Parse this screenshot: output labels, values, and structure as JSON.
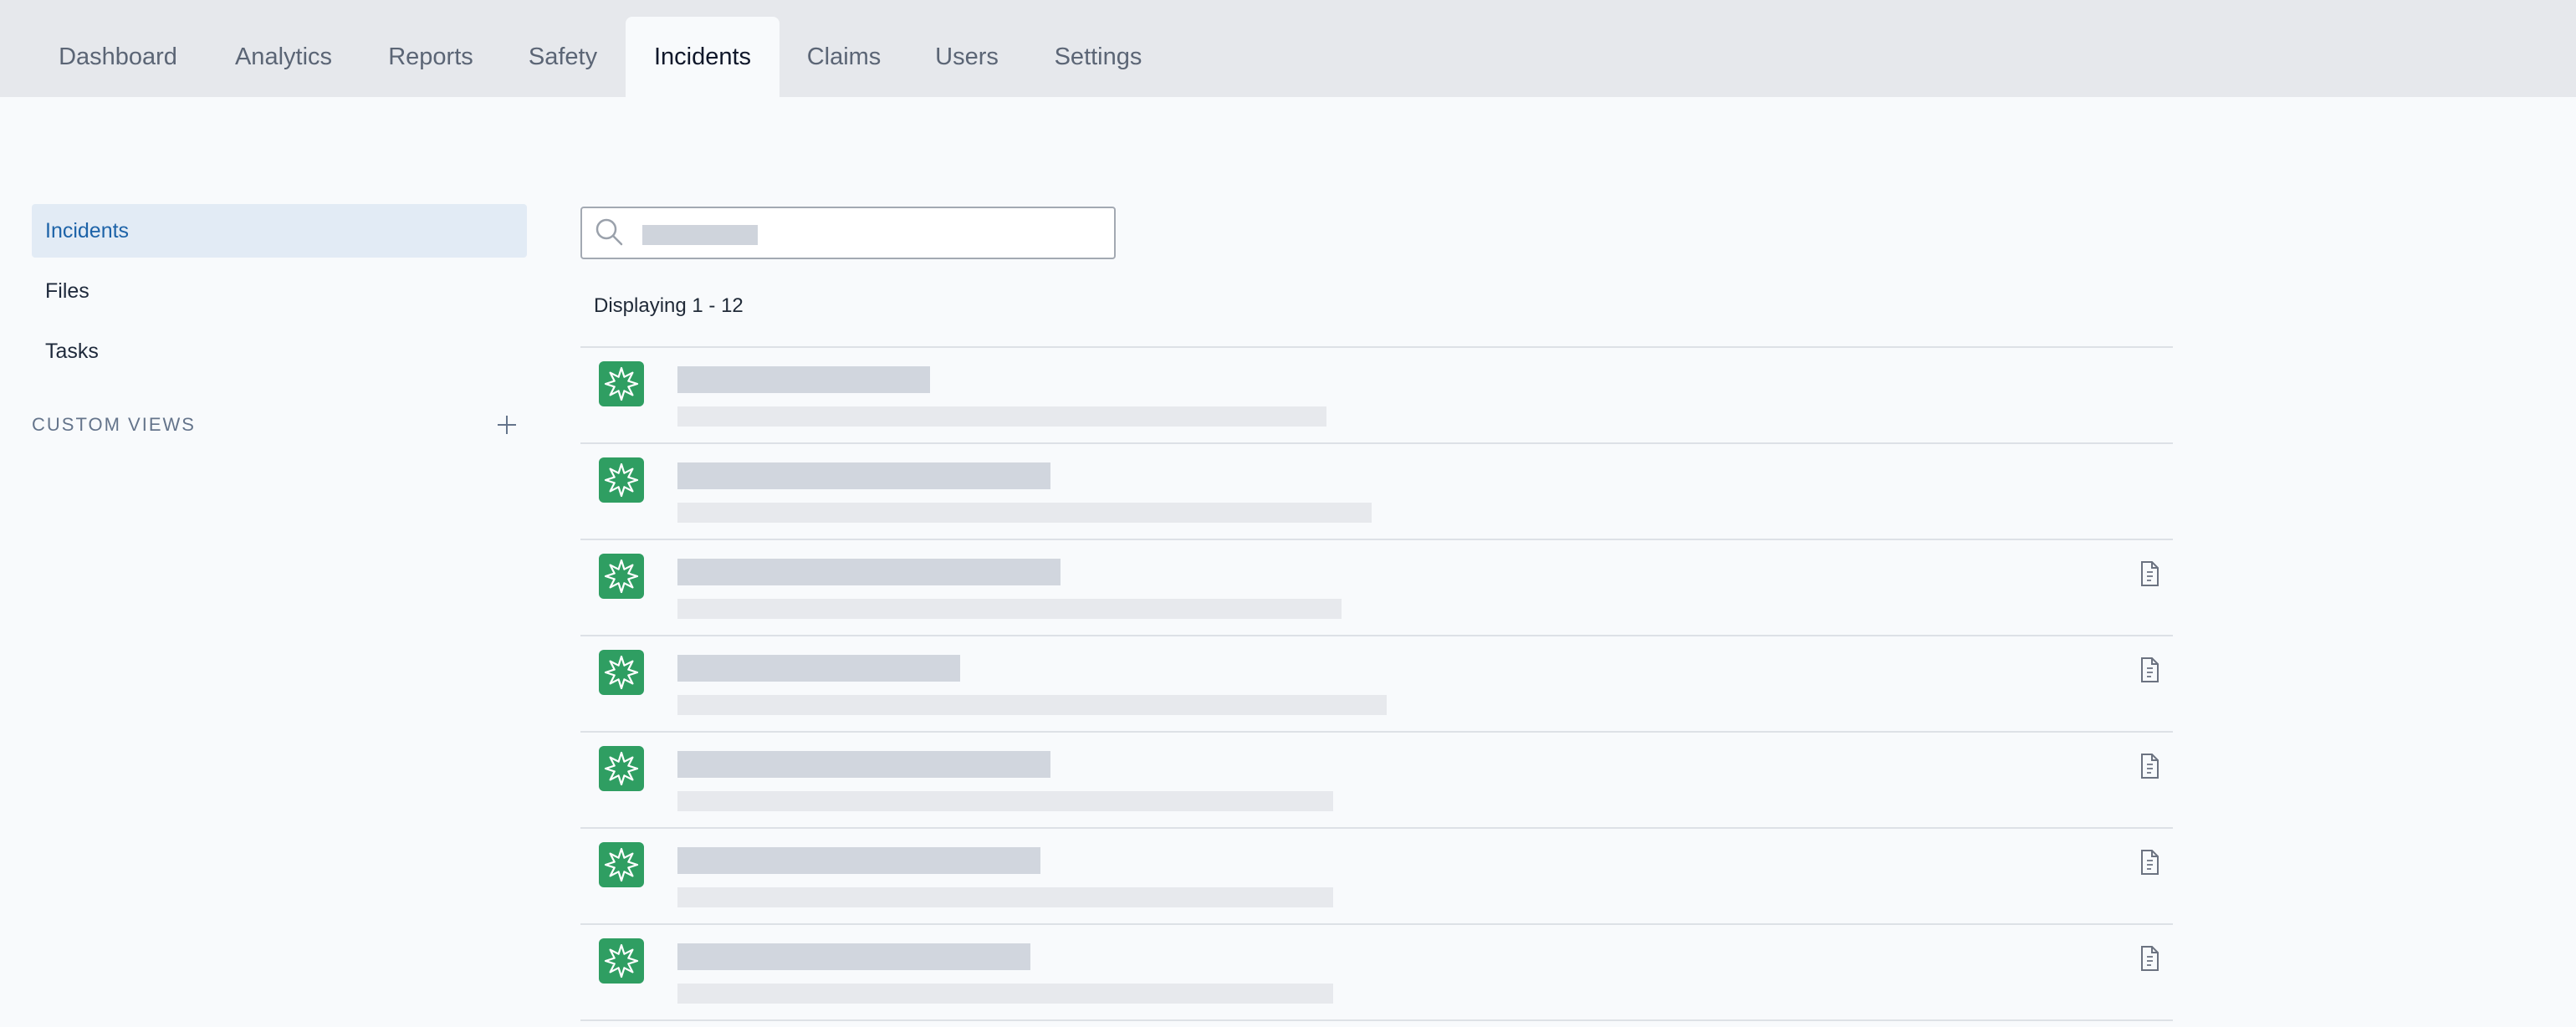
{
  "tabs": [
    {
      "label": "Dashboard",
      "active": false
    },
    {
      "label": "Analytics",
      "active": false
    },
    {
      "label": "Reports",
      "active": false
    },
    {
      "label": "Safety",
      "active": false
    },
    {
      "label": "Incidents",
      "active": true
    },
    {
      "label": "Claims",
      "active": false
    },
    {
      "label": "Users",
      "active": false
    },
    {
      "label": "Settings",
      "active": false
    }
  ],
  "sidebar": {
    "items": [
      {
        "label": "Incidents",
        "active": true
      },
      {
        "label": "Files",
        "active": false
      },
      {
        "label": "Tasks",
        "active": false
      }
    ],
    "custom_views_label": "CUSTOM VIEWS"
  },
  "search": {
    "value": "",
    "placeholder": ""
  },
  "result_summary": "Displaying 1 - 12",
  "list": {
    "rows": [
      {
        "icon": "incident-burst-icon",
        "has_attachment": false
      },
      {
        "icon": "incident-burst-icon",
        "has_attachment": false
      },
      {
        "icon": "incident-burst-icon",
        "has_attachment": true
      },
      {
        "icon": "incident-burst-icon",
        "has_attachment": true
      },
      {
        "icon": "incident-burst-icon",
        "has_attachment": true
      },
      {
        "icon": "incident-burst-icon",
        "has_attachment": true
      },
      {
        "icon": "incident-burst-icon",
        "has_attachment": true
      }
    ]
  },
  "colors": {
    "accent": "#1d63a8",
    "incident_icon": "#2f9e62",
    "tabbar": "#e6e8ec",
    "background": "#f8fafc"
  }
}
